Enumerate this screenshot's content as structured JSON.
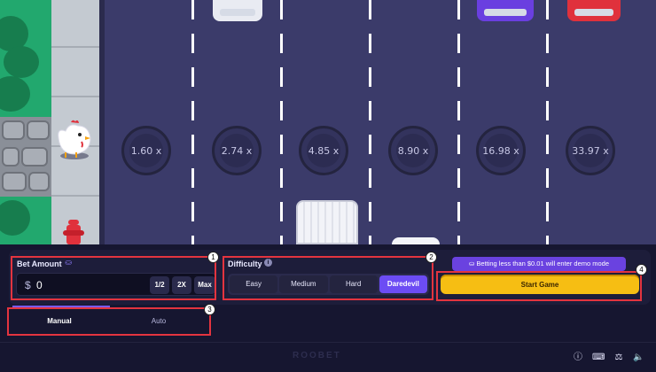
{
  "multipliers": [
    "1.60 x",
    "2.74 x",
    "4.85 x",
    "8.90 x",
    "16.98 x",
    "33.97 x"
  ],
  "bet": {
    "label": "Bet Amount",
    "currency_symbol": "$",
    "value": "0",
    "half": "1/2",
    "double": "2X",
    "max": "Max"
  },
  "difficulty": {
    "label": "Difficulty",
    "info": "i",
    "options": [
      "Easy",
      "Medium",
      "Hard",
      "Daredevil"
    ],
    "selected": "Daredevil"
  },
  "demo_note": "Betting less than $0.01 will enter demo mode",
  "start_label": "Start Game",
  "modes": {
    "manual": "Manual",
    "auto": "Auto"
  },
  "brand": "ROOBET",
  "markers": [
    "1",
    "2",
    "3",
    "4"
  ],
  "colors": {
    "accent": "#6c4cf4",
    "start": "#f6be13",
    "annotation": "#e3343f",
    "road": "#3b3b6a",
    "panel": "#161630"
  },
  "icons": {
    "bet_label_icon": "coin-stack-icon",
    "demo_icon": "coin-stack-icon",
    "footer": [
      "info-icon",
      "keyboard-icon",
      "balance-scale-icon",
      "speaker-icon"
    ]
  }
}
